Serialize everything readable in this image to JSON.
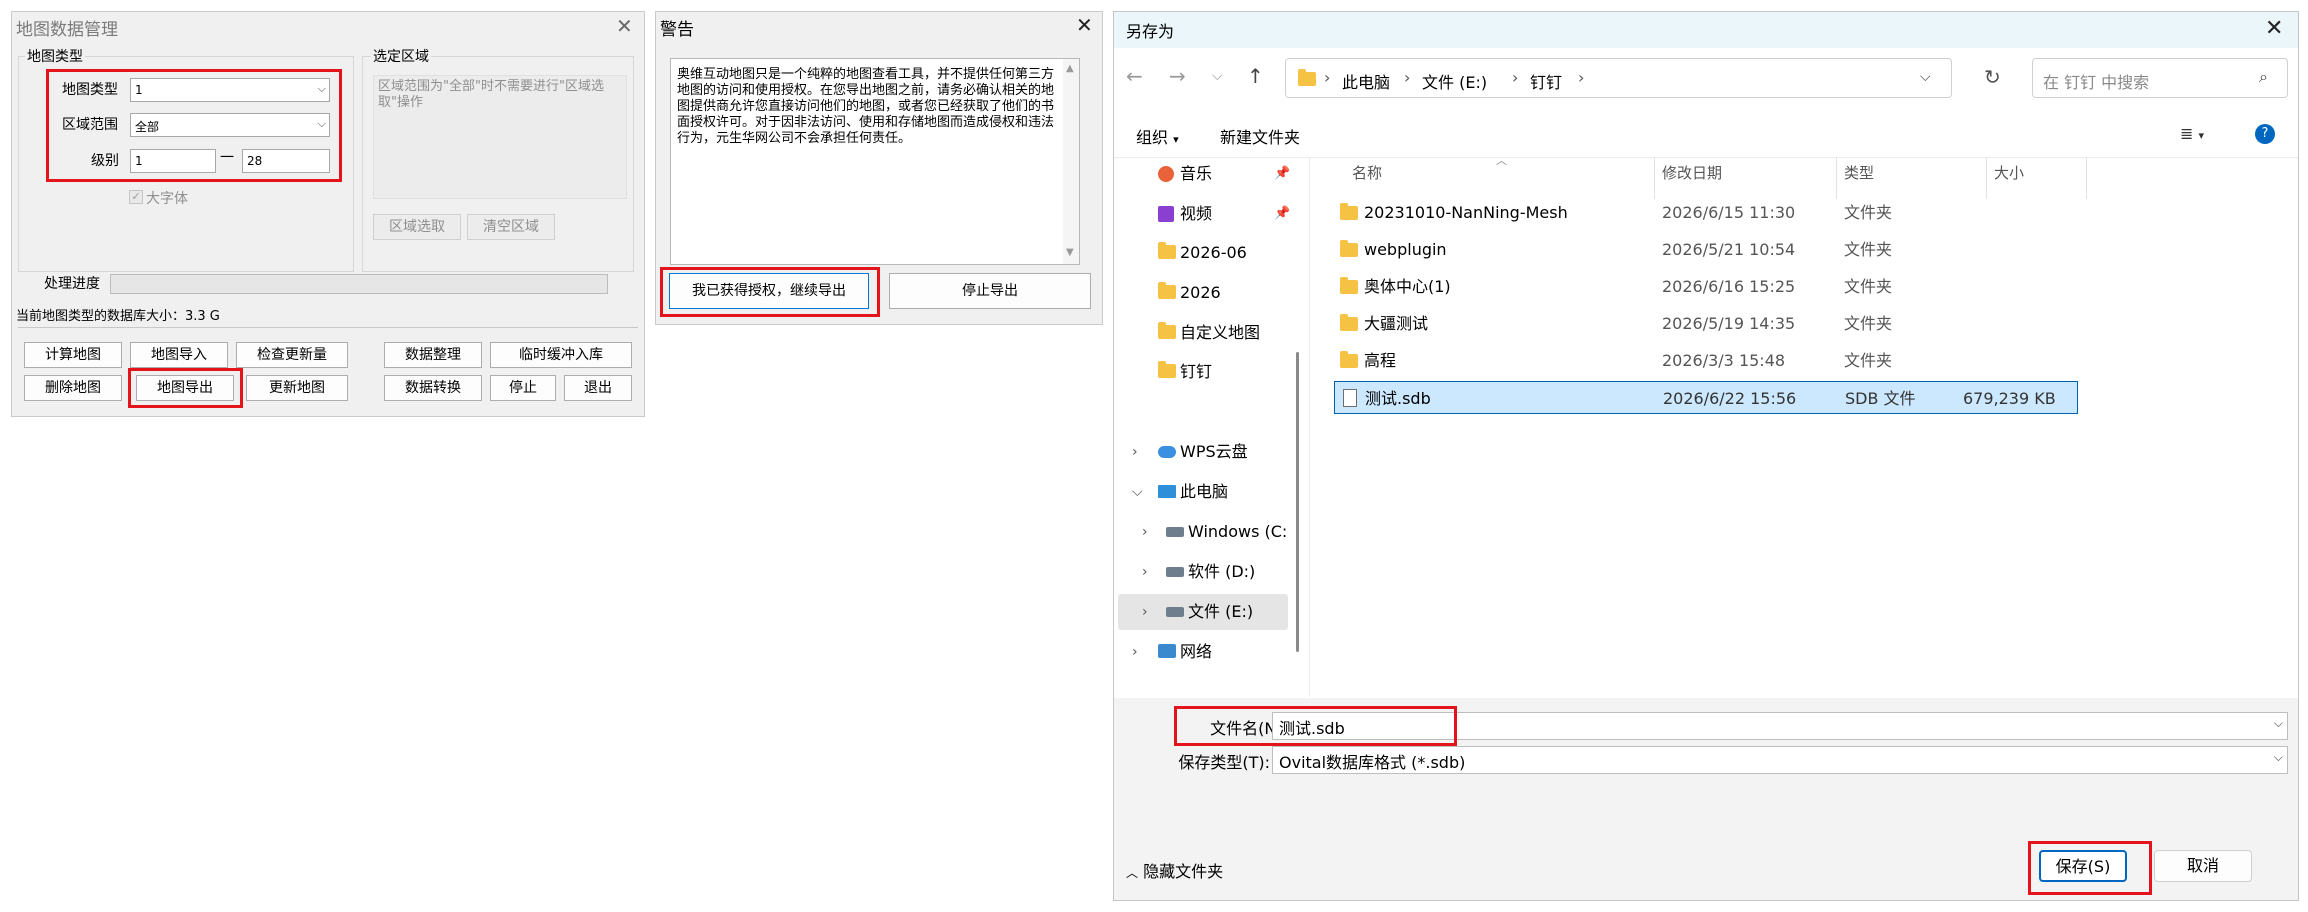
{
  "map_manager": {
    "title": "地图数据管理",
    "map_group_label": "地图类型",
    "region_group_label": "选定区域",
    "map_type_label": "地图类型",
    "map_type_value": "1",
    "area_label": "区域范围",
    "area_value": "全部",
    "level_label": "级别",
    "level_from": "1",
    "level_dash": "一",
    "level_to": "28",
    "big_font_label": "大字体",
    "region_hint": "区域范围为\"全部\"时不需要进行\"区域选取\"操作",
    "region_select_btn": "区域选取",
    "region_clear_btn": "清空区域",
    "progress_label": "处理进度",
    "progress": 0,
    "db_size_text": "当前地图类型的数据库大小：3.3 G",
    "buttons": {
      "calc": "计算地图",
      "import": "地图导入",
      "check_update": "检查更新量",
      "organize": "数据整理",
      "temp_buffer": "临时缓冲入库",
      "delete": "删除地图",
      "export": "地图导出",
      "update": "更新地图",
      "convert": "数据转换",
      "stop": "停止",
      "exit": "退出"
    }
  },
  "warning": {
    "title": "警告",
    "text": "奥维互动地图只是一个纯粹的地图查看工具，并不提供任何第三方地图的访问和使用授权。在您导出地图之前，请务必确认相关的地图提供商允许您直接访问他们的地图，或者您已经获取了他们的书面授权许可。对于因非法访问、使用和存储地图而造成侵权和违法行为，元生华网公司不会承担任何责任。",
    "continue_btn": "我已获得授权，继续导出",
    "stop_btn": "停止导出"
  },
  "save_dialog": {
    "title": "另存为",
    "breadcrumb": [
      "此电脑",
      "文件 (E:)",
      "钉钉"
    ],
    "search_placeholder": "在 钉钉 中搜索",
    "organize_label": "组织",
    "new_folder_label": "新建文件夹",
    "sidebar": [
      {
        "label": "音乐",
        "icon": "music-icon",
        "pinned": true
      },
      {
        "label": "视频",
        "icon": "video-icon",
        "pinned": true
      },
      {
        "label": "2026-06",
        "icon": "folder-icon",
        "pinned": false
      },
      {
        "label": "2026",
        "icon": "folder-icon",
        "pinned": false
      },
      {
        "label": "自定义地图",
        "icon": "folder-icon",
        "pinned": false
      },
      {
        "label": "钉钉",
        "icon": "folder-icon",
        "pinned": false
      },
      {
        "label": "WPS云盘",
        "icon": "cloud-icon",
        "pinned": false
      },
      {
        "label": "此电脑",
        "icon": "computer-icon",
        "pinned": false
      },
      {
        "label": "Windows (C:",
        "icon": "drive-icon",
        "pinned": false
      },
      {
        "label": "软件 (D:)",
        "icon": "drive-icon",
        "pinned": false
      },
      {
        "label": "文件 (E:)",
        "icon": "drive-icon",
        "pinned": false
      },
      {
        "label": "网络",
        "icon": "network-icon",
        "pinned": false
      }
    ],
    "columns": {
      "name": "名称",
      "modified": "修改日期",
      "type": "类型",
      "size": "大小"
    },
    "files": [
      {
        "name": "20231010-NanNing-Mesh",
        "modified": "2026/6/15 11:30",
        "type": "文件夹",
        "size": ""
      },
      {
        "name": "webplugin",
        "modified": "2026/5/21 10:54",
        "type": "文件夹",
        "size": ""
      },
      {
        "name": "奥体中心(1)",
        "modified": "2026/6/16 15:25",
        "type": "文件夹",
        "size": ""
      },
      {
        "name": "大疆测试",
        "modified": "2026/5/19 14:35",
        "type": "文件夹",
        "size": ""
      },
      {
        "name": "高程",
        "modified": "2026/3/3 15:48",
        "type": "文件夹",
        "size": ""
      },
      {
        "name": "测试.sdb",
        "modified": "2026/6/22 15:56",
        "type": "SDB 文件",
        "size": "679,239 KB"
      }
    ],
    "filename_label": "文件名(N):",
    "filename_value": "测试.sdb",
    "filetype_label": "保存类型(T):",
    "filetype_value": "Ovital数据库格式 (*.sdb)",
    "hide_folders_label": "隐藏文件夹",
    "save_btn": "保存(S)",
    "cancel_btn": "取消"
  }
}
